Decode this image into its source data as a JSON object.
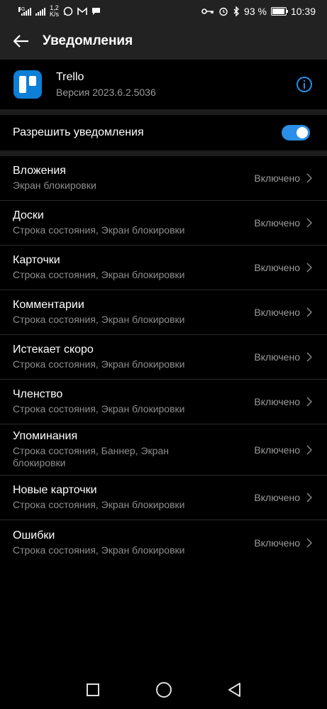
{
  "status_bar": {
    "net_label": "4G",
    "speed_value": "1,2",
    "speed_unit": "K/s",
    "battery_percent": "93 %",
    "time": "10:39",
    "notification_icons": [
      "whatsapp-icon",
      "gmail-icon",
      "message-icon"
    ],
    "status_icons": [
      "key-icon",
      "alarm-icon",
      "bluetooth-icon"
    ]
  },
  "app_bar": {
    "title": "Уведомления"
  },
  "app": {
    "name": "Trello",
    "version": "Версия 2023.6.2.5036",
    "logo_color": "#0c7fd6"
  },
  "allow": {
    "label": "Разрешить уведомления",
    "enabled": true,
    "accent": "#2a8ee8"
  },
  "channels": [
    {
      "title": "Вложения",
      "subtitle": "Экран блокировки",
      "status": "Включено"
    },
    {
      "title": "Доски",
      "subtitle": "Строка состояния, Экран блокировки",
      "status": "Включено"
    },
    {
      "title": "Карточки",
      "subtitle": "Строка состояния, Экран блокировки",
      "status": "Включено"
    },
    {
      "title": "Комментарии",
      "subtitle": "Строка состояния, Экран блокировки",
      "status": "Включено"
    },
    {
      "title": "Истекает скоро",
      "subtitle": "Строка состояния, Экран блокировки",
      "status": "Включено"
    },
    {
      "title": "Членство",
      "subtitle": "Строка состояния, Экран блокировки",
      "status": "Включено"
    },
    {
      "title": "Упоминания",
      "subtitle": "Строка состояния, Баннер, Экран блокировки",
      "status": "Включено"
    },
    {
      "title": "Новые карточки",
      "subtitle": "Строка состояния, Экран блокировки",
      "status": "Включено"
    },
    {
      "title": "Ошибки",
      "subtitle": "Строка состояния, Экран блокировки",
      "status": "Включено"
    }
  ],
  "nav": {
    "icons": [
      "recents-square-icon",
      "home-circle-icon",
      "back-triangle-icon"
    ]
  }
}
